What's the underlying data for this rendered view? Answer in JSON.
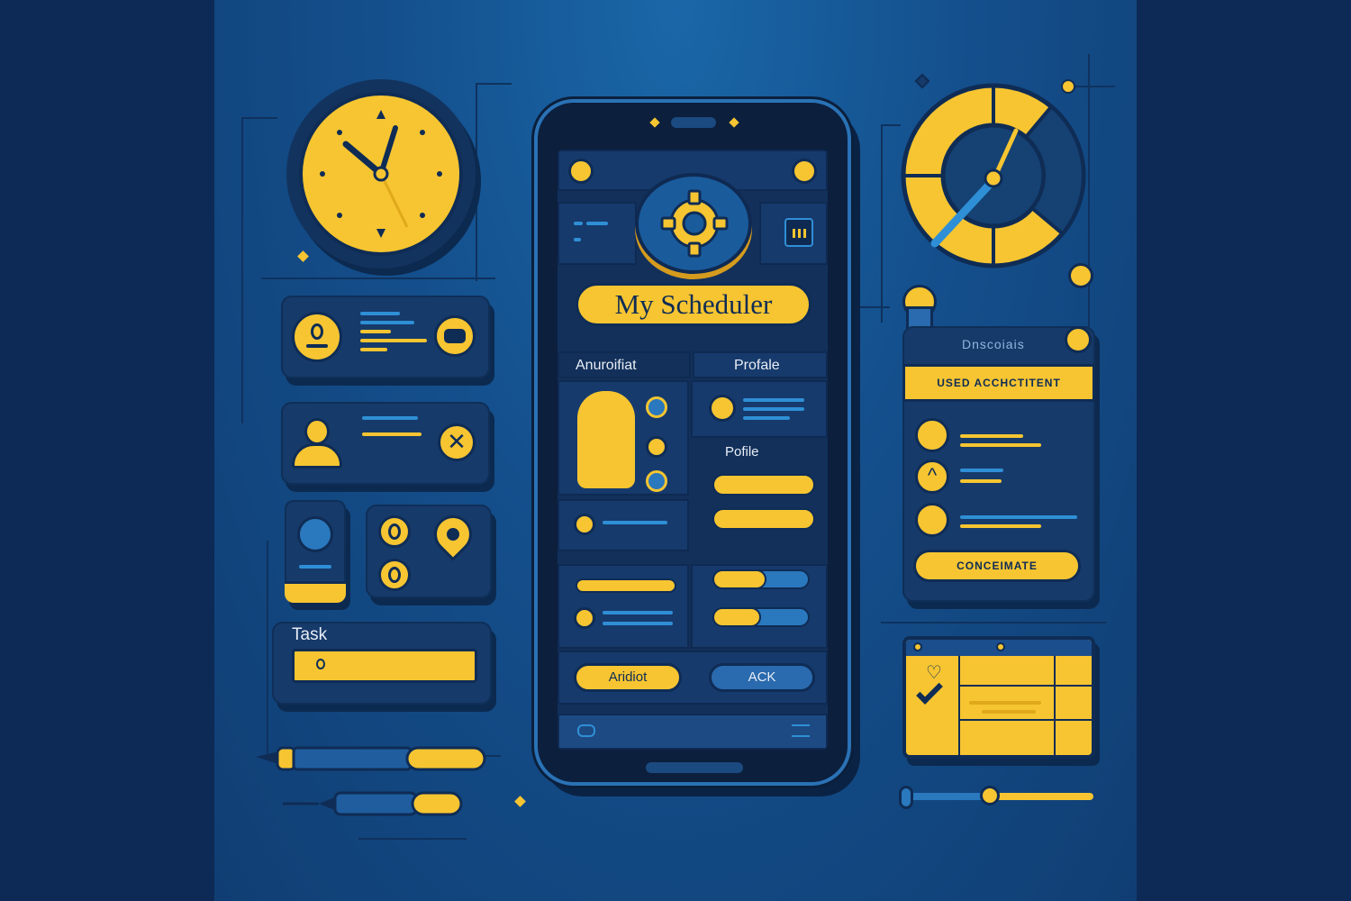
{
  "app": {
    "title": "My Scheduler",
    "tab_left": "Anuroifiat",
    "tab_right": "Profale",
    "profile_label": "Pofile",
    "button_left": "Aridiot",
    "button_right": "ACK"
  },
  "left_widgets": {
    "task_label": "Task"
  },
  "right_panel": {
    "header": "Dnscoiais",
    "top_button": "USED ACCHCTITENT",
    "bottom_button": "CONCEIMATE"
  },
  "colors": {
    "accent": "#f6c531",
    "background": "#144f8c",
    "panel": "#163a6a",
    "outline": "#0f2c55"
  },
  "icons": [
    "clock-icon",
    "gear-icon",
    "speedometer-icon",
    "user-icon",
    "close-icon",
    "pin-icon",
    "calendar-icon",
    "pen-icon",
    "heart-icon",
    "check-icon"
  ]
}
